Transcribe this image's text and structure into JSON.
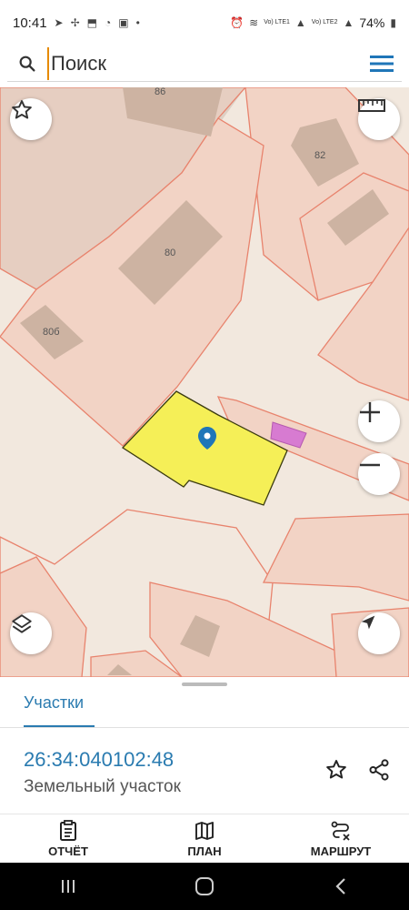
{
  "status": {
    "time": "10:41",
    "battery": "74%",
    "lte1": "Vo) LTE1",
    "lte2": "Vo) LTE2"
  },
  "search": {
    "placeholder": "Поиск"
  },
  "map": {
    "labels": {
      "b86": "86",
      "b82": "82",
      "b80": "80",
      "b80b": "80б"
    },
    "colors": {
      "selected_parcel": "#f5ef57",
      "parcel_border": "#e8836d",
      "building": "#cdb3a2",
      "highlight_building": "#d77bd1",
      "pin": "#1f76b8"
    }
  },
  "sheet": {
    "tab_label": "Участки",
    "cadastral_number": "26:34:040102:48",
    "object_type": "Земельный участок"
  },
  "actions": [
    {
      "label": "ОТЧЁТ",
      "icon": "report-icon"
    },
    {
      "label": "ПЛАН",
      "icon": "map-icon"
    },
    {
      "label": "МАРШРУТ",
      "icon": "route-icon"
    }
  ]
}
